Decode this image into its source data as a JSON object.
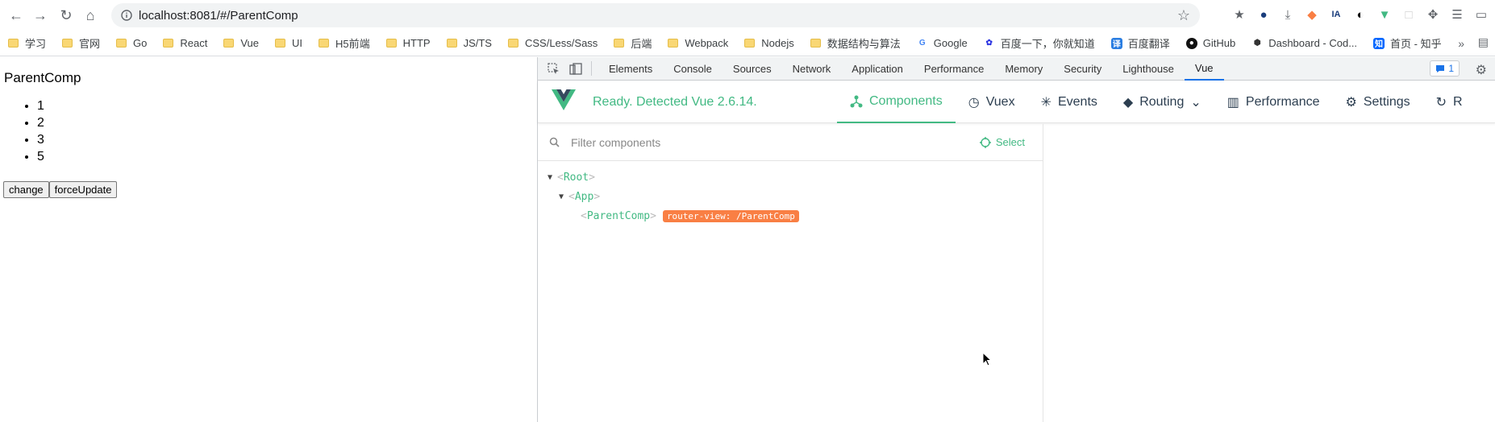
{
  "browser": {
    "url": "localhost:8081/#/ParentComp",
    "bookmarks": [
      {
        "label": "学习",
        "type": "folder"
      },
      {
        "label": "官网",
        "type": "folder"
      },
      {
        "label": "Go",
        "type": "folder"
      },
      {
        "label": "React",
        "type": "folder"
      },
      {
        "label": "Vue",
        "type": "folder"
      },
      {
        "label": "UI",
        "type": "folder"
      },
      {
        "label": "H5前端",
        "type": "folder"
      },
      {
        "label": "HTTP",
        "type": "folder"
      },
      {
        "label": "JS/TS",
        "type": "folder"
      },
      {
        "label": "CSS/Less/Sass",
        "type": "folder"
      },
      {
        "label": "后端",
        "type": "folder"
      },
      {
        "label": "Webpack",
        "type": "folder"
      },
      {
        "label": "Nodejs",
        "type": "folder"
      },
      {
        "label": "数据结构与算法",
        "type": "folder"
      },
      {
        "label": "Google",
        "type": "site"
      },
      {
        "label": "百度一下，你就知道",
        "type": "site"
      },
      {
        "label": "百度翻译",
        "type": "site"
      },
      {
        "label": "GitHub",
        "type": "site"
      },
      {
        "label": "Dashboard - Cod...",
        "type": "site"
      },
      {
        "label": "首页 - 知乎",
        "type": "site"
      }
    ],
    "more_bookmarks": "»"
  },
  "page": {
    "title": "ParentComp",
    "items": [
      "1",
      "2",
      "3",
      "5"
    ],
    "change_label": "change",
    "force_update_label": "forceUpdate"
  },
  "devtools": {
    "tabs": [
      "Elements",
      "Console",
      "Sources",
      "Network",
      "Application",
      "Performance",
      "Memory",
      "Security",
      "Lighthouse",
      "Vue"
    ],
    "active_tab": "Vue",
    "issues_count": "1"
  },
  "vue": {
    "status": "Ready. Detected Vue 2.6.14.",
    "nav": [
      {
        "label": "Components",
        "icon": "components-icon"
      },
      {
        "label": "Vuex",
        "icon": "history-icon"
      },
      {
        "label": "Events",
        "icon": "events-icon"
      },
      {
        "label": "Routing",
        "icon": "routing-icon"
      },
      {
        "label": "Performance",
        "icon": "performance-icon"
      },
      {
        "label": "Settings",
        "icon": "settings-icon"
      },
      {
        "label": "R",
        "icon": "refresh-icon"
      }
    ],
    "filter_placeholder": "Filter components",
    "select_label": "Select",
    "tree": {
      "root": "Root",
      "app": "App",
      "parent_comp": "ParentComp",
      "router_tag": "router-view: /ParentComp"
    }
  },
  "colors": {
    "vue_green": "#42b983",
    "router_tag_bg": "#f97f44",
    "devtools_active": "#1a73e8"
  }
}
